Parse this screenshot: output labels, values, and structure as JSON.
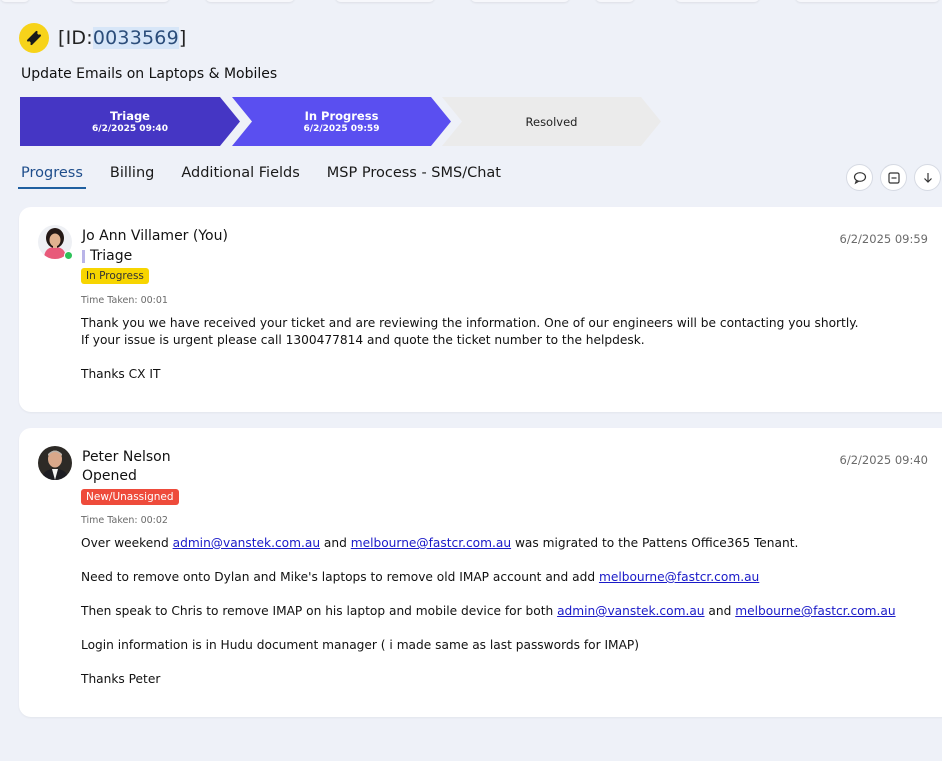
{
  "ticket": {
    "id_prefix": "[ID:",
    "id_number": "0033569",
    "id_suffix": "]",
    "subject": "Update Emails on Laptops & Mobiles"
  },
  "stages": [
    {
      "label": "Triage",
      "date": "6/2/2025 09:40",
      "color": "#4536c4"
    },
    {
      "label": "In Progress",
      "date": "6/2/2025 09:59",
      "color": "#5a4ff0"
    },
    {
      "label": "Resolved",
      "date": "",
      "color": "#ebebeb"
    }
  ],
  "tabs": [
    "Progress",
    "Billing",
    "Additional Fields",
    "MSP Process - SMS/Chat"
  ],
  "tools": [
    "comment-icon",
    "collapse-icon",
    "download-icon"
  ],
  "entries": [
    {
      "author": "Jo Ann Villamer (You)",
      "stage": "Triage",
      "status": "In Progress",
      "time_taken": "Time Taken: 00:01",
      "timestamp": "6/2/2025 09:59",
      "lines": [
        "Thank you we have received your ticket and are reviewing the information. One of our engineers will be contacting you shortly.",
        "If your issue is urgent please call 1300477814 and quote the ticket number to the helpdesk.",
        "Thanks CX IT"
      ]
    },
    {
      "author": "Peter Nelson",
      "stage": "Opened",
      "status": "New/Unassigned",
      "time_taken": "Time Taken: 00:02",
      "timestamp": "6/2/2025 09:40",
      "p1": {
        "a": "Over weekend ",
        "link1": "admin@vanstek.com.au",
        "b": " and ",
        "link2": "melbourne@fastcr.com.au",
        "c": " was migrated to the Pattens Office365 Tenant."
      },
      "p2": {
        "a": "Need to remove onto Dylan and Mike's laptops to remove old IMAP account and add ",
        "link1": "melbourne@fastcr.com.au"
      },
      "p3": {
        "a": "Then speak to Chris to remove IMAP on his laptop and mobile device for both ",
        "link1": "admin@vanstek.com.au",
        "b": " and ",
        "link2": "melbourne@fastcr.com.au"
      },
      "p4": "Login information is in Hudu document manager ( i made same as last passwords for IMAP)",
      "p5": "Thanks Peter"
    }
  ]
}
